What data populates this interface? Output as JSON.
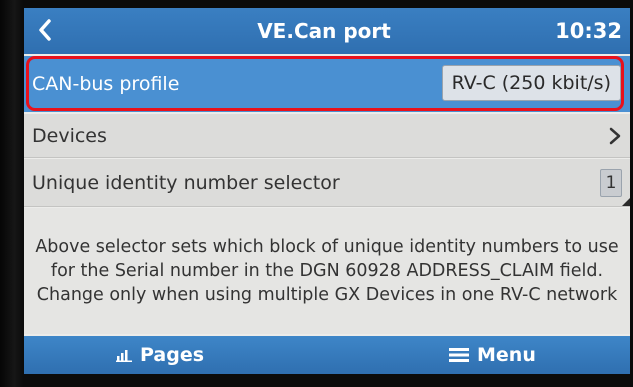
{
  "header": {
    "title": "VE.Can port",
    "time": "10:32"
  },
  "rows": {
    "can_profile": {
      "label": "CAN-bus profile",
      "value": "RV-C (250 kbit/s)"
    },
    "devices": {
      "label": "Devices"
    },
    "unique_selector": {
      "label": "Unique identity number selector",
      "value": "1"
    }
  },
  "info": {
    "text": "Above selector sets which block of unique identity numbers to use for the Serial number in the DGN 60928 ADDRESS_CLAIM field. Change only when using multiple GX Devices in one RV-C network"
  },
  "footer": {
    "pages_label": "Pages",
    "menu_label": "Menu"
  },
  "icons": {
    "back": "back-arrow-icon",
    "chevron": "chevron-right-icon",
    "pages": "bar-chart-icon",
    "menu": "hamburger-menu-icon"
  },
  "colors": {
    "header": "#2f6fb0",
    "selected_row": "#4a90d2",
    "highlight_outline": "#e8111b",
    "background": "#ececea"
  }
}
